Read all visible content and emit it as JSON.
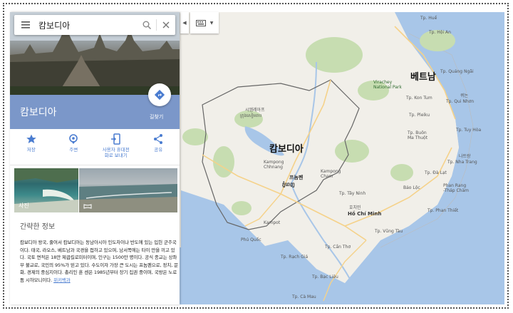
{
  "search": {
    "query": "캄보디아"
  },
  "place": {
    "title": "캄보디아",
    "directions_label": "길찾기"
  },
  "actions": [
    {
      "label": "저장",
      "icon": "star-icon"
    },
    {
      "label": "주변",
      "icon": "location-pin-icon"
    },
    {
      "label": "사용자 휴대전\n화로 보내기",
      "icon": "send-to-phone-icon"
    },
    {
      "label": "공유",
      "icon": "share-icon"
    }
  ],
  "photos": {
    "label": "사진"
  },
  "overview": {
    "heading": "간략한 정보",
    "text": "캄보디아 왕국, 줄여서 캄보디아는 동남아시아 인도차이나 반도에 있는 입헌 군주국이다. 태국, 라오스, 베트남과 국경을 접하고 있으며, 남서쪽에는 타이 만을 끼고 있다. 국토 면적은 18만 제곱킬로미터이며, 인구는 1500만 명이다. 공식 종교는 상좌부 불교로, 국민의 95%가 믿고 있다. 수도이자 가장 큰 도시는 프놈펜으로, 정치, 문화, 경제의 중심지이다. 총리인 훈 센은 1985년부터 장기 집권 중이며, 국왕은 노로돔 시하모니이다. ",
    "link": "위키백과"
  },
  "map": {
    "country_label": "캄보디아",
    "vietnam_label": "베트남",
    "phnom_penh_ko": "프놈펜",
    "phnom_penh_km": "ភ្នំពេញ",
    "ho_chi_minh": "Hồ Chí Minh",
    "ho_chi_minh_ko": "호치민",
    "siem_reap_ko": "시엠레아프",
    "siem_reap_km": "ក្រុងសៀមរាប",
    "virachey": "Virachey\nNational Park",
    "kampong_chhnang": "Kampong\nChhnang",
    "labels": [
      {
        "text": "Tp. Huế"
      },
      {
        "text": "Tp. Hội An"
      },
      {
        "text": "Tp. Quảng Ngãi"
      },
      {
        "text": "퀴논"
      },
      {
        "text": "Tp. Qui Nhơn"
      },
      {
        "text": "Tp. Tuy Hòa"
      },
      {
        "text": "나트랑"
      },
      {
        "text": "Tp. Nha Trang"
      },
      {
        "text": "Tp. Đà Lạt"
      },
      {
        "text": "Phan Rang\n-Tháp Chàm"
      },
      {
        "text": "Tp. Phan Thiết"
      },
      {
        "text": "Bảo Lộc"
      },
      {
        "text": "Tp. Vũng Tàu"
      },
      {
        "text": "Tp. Cần Thơ"
      },
      {
        "text": "Tp. Rạch Giá"
      },
      {
        "text": "Tp. Bạc Liêu"
      },
      {
        "text": "Tp. Cà Mau"
      },
      {
        "text": "Phú Quốc"
      },
      {
        "text": "Tp. Tây Ninh"
      },
      {
        "text": "Tp. Buôn\nMa Thuột"
      },
      {
        "text": "Kampot"
      },
      {
        "text": "Kampong\nCham"
      },
      {
        "text": "Tp. Kon Tum"
      },
      {
        "text": "Tp. Pleiku"
      }
    ]
  },
  "colors": {
    "accent": "#7b97c9",
    "link": "#4a7cd0",
    "water": "#a8c6e8",
    "land": "#f1efe9",
    "forest": "#c7ddb1"
  }
}
